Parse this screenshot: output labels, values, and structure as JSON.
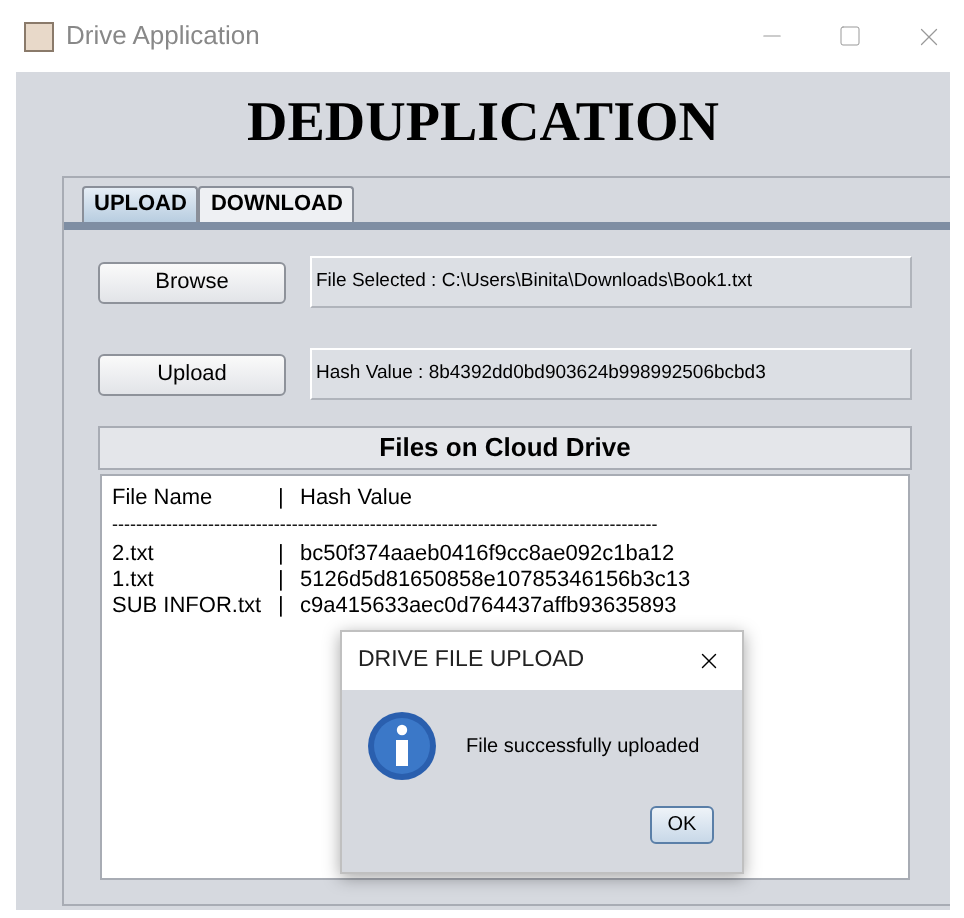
{
  "window": {
    "title": "Drive Application"
  },
  "heading": "DEDUPLICATION",
  "tabs": [
    {
      "label": "UPLOAD",
      "selected": true
    },
    {
      "label": "DOWNLOAD",
      "selected": false
    }
  ],
  "browse": {
    "button": "Browse",
    "value": "File Selected : C:\\Users\\Binita\\Downloads\\Book1.txt"
  },
  "upload": {
    "button": "Upload",
    "value": "Hash Value : 8b4392dd0bd903624b998992506bcbd3"
  },
  "files_panel": {
    "title": "Files on Cloud Drive",
    "header": {
      "name": "File Name",
      "bar": "|",
      "hash": "Hash Value"
    },
    "rule": "-------------------------------------------------------------------------------------------",
    "rows": [
      {
        "name": "2.txt",
        "bar": "|",
        "hash": "bc50f374aaeb0416f9cc8ae092c1ba12"
      },
      {
        "name": "1.txt",
        "bar": "|",
        "hash": "5126d5d81650858e10785346156b3c13"
      },
      {
        "name": "SUB INFOR.txt",
        "bar": "|",
        "hash": "c9a415633aec0d764437affb93635893"
      }
    ]
  },
  "dialog": {
    "title": "DRIVE FILE UPLOAD",
    "message": "File successfully uploaded",
    "button": "OK"
  }
}
